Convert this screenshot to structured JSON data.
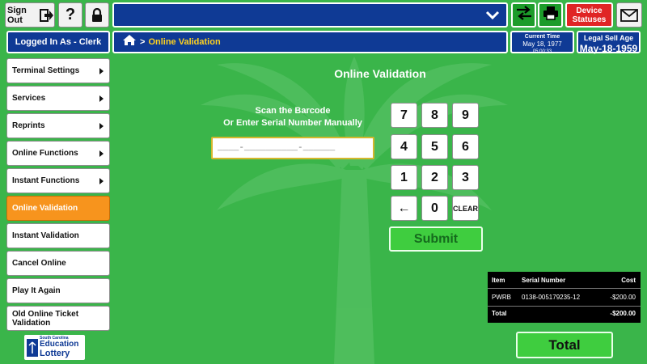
{
  "colors": {
    "background": "#3ab54a",
    "primary_blue": "#0f3a95",
    "active_orange": "#f7941d",
    "alert_red": "#e02525",
    "accent_yellow": "#ffd21f",
    "submit_green": "#3fcd3f"
  },
  "topbar": {
    "sign_out_label": "Sign Out",
    "sign_out_icon": "sign-out-arrow-icon",
    "help_label": "?",
    "lock_icon": "lock-icon",
    "game_select_value": "",
    "game_select_icon": "chevron-down-icon",
    "switch_icon": "swap-arrows-icon",
    "printer_icon": "printer-icon",
    "device_statuses_label": "Device Statuses",
    "mail_icon": "envelope-icon"
  },
  "header": {
    "logged_in": "Logged In As - Clerk",
    "home_icon": "home-icon",
    "breadcrumb_sep": ">",
    "breadcrumb": "Online Validation",
    "current_time_label": "Current Time",
    "current_date": "May 18, 1977",
    "current_time": "05:00:33",
    "legal_age_label": "Legal Sell Age",
    "legal_age_value": "May-18-1959"
  },
  "sidebar": {
    "items": [
      {
        "label": "Terminal Settings",
        "has_submenu": true,
        "active": false
      },
      {
        "label": "Services",
        "has_submenu": true,
        "active": false
      },
      {
        "label": "Reprints",
        "has_submenu": true,
        "active": false
      },
      {
        "label": "Online Functions",
        "has_submenu": true,
        "active": false
      },
      {
        "label": "Instant Functions",
        "has_submenu": true,
        "active": false
      },
      {
        "label": "Online Validation",
        "has_submenu": false,
        "active": true
      },
      {
        "label": "Instant Validation",
        "has_submenu": false,
        "active": false
      },
      {
        "label": "Cancel Online",
        "has_submenu": false,
        "active": false
      },
      {
        "label": "Play It Again",
        "has_submenu": false,
        "active": false
      },
      {
        "label": "Old Online Ticket Validation",
        "has_submenu": false,
        "active": false
      }
    ]
  },
  "main": {
    "title": "Online Validation",
    "scan_line1": "Scan the Barcode",
    "scan_line2": "Or Enter Serial Number Manually",
    "serial_input_value": "",
    "serial_placeholder": "____-__________-______",
    "keypad": [
      "7",
      "8",
      "9",
      "4",
      "5",
      "6",
      "1",
      "2",
      "3",
      "←",
      "0",
      "CLEAR"
    ],
    "submit_label": "Submit"
  },
  "item_table": {
    "headers": [
      "Item",
      "Serial Number",
      "Cost"
    ],
    "rows": [
      {
        "item": "PWRB",
        "serial": "0138-005179235-12",
        "cost": "-$200.00"
      }
    ],
    "total_label": "Total",
    "total_value": "-$200.00"
  },
  "total_button_label": "Total",
  "logo": {
    "line1": "South Carolina",
    "line2": "Education",
    "line3": "Lottery"
  }
}
